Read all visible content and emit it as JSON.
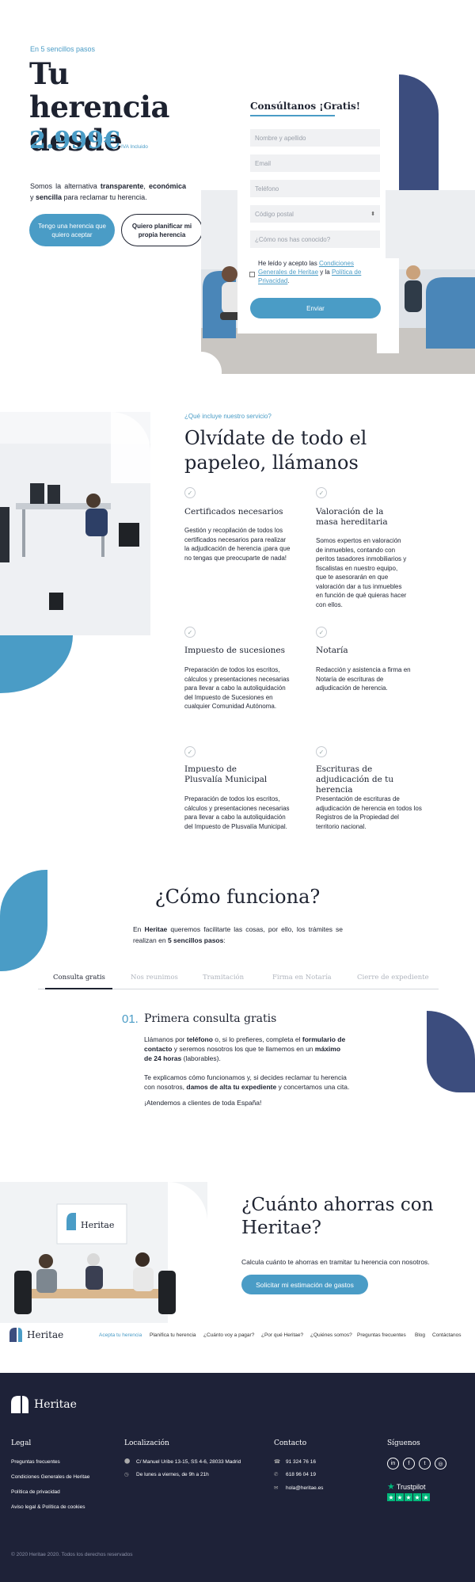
{
  "hero": {
    "kicker": "En 5 sencillos pasos",
    "title_line1": "Tu herencia",
    "title_line2": "desde",
    "price": "2.999€",
    "price_note": "IVA Incluido",
    "desc_pre": "Somos la alternativa ",
    "desc_b1": "transparente",
    "desc_mid": ", ",
    "desc_b2": "económica",
    "desc_and": " y ",
    "desc_b3": "sencilla",
    "desc_post": " para reclamar tu herencia.",
    "btn_accept": "Tengo una herencia que quiero aceptar",
    "btn_plan": "Quiero planificar mi propia herencia"
  },
  "form": {
    "title": "Consúltanos ¡Gratis!",
    "name_placeholder": "Nombre y apellido",
    "email_placeholder": "Email",
    "phone_placeholder": "Teléfono",
    "postal_placeholder": "Código postal",
    "source_placeholder": "¿Cómo nos has conocido?",
    "legal_pre": "He leído y acepto las ",
    "legal_link1": "Condiciones Generales de Heritae",
    "legal_mid": " y la ",
    "legal_link2": "Política de Privacidad",
    "legal_post": ".",
    "submit": "Enviar"
  },
  "services": {
    "kicker": "¿Qué incluye nuestro servicio?",
    "title": "Olvídate de todo el papeleo, llámanos",
    "items": [
      {
        "title": "Certificados necesarios",
        "desc": "Gestión y recopilación de todos los certificados necesarios para realizar la adjudicación de herencia ¡para que no tengas que preocuparte de nada!"
      },
      {
        "title": "Valoración de la masa hereditaria",
        "desc": "Somos expertos en valoración de inmuebles, contando con peritos tasadores inmobiliarios y fiscalistas en nuestro equipo, que te asesorarán en que valoración dar a tus inmuebles en función de qué quieras hacer con ellos."
      },
      {
        "title": "Impuesto de sucesiones",
        "desc": "Preparación de todos los escritos, cálculos y presentaciones necesarias para llevar a cabo la autoliquidación del Impuesto de Sucesiones en cualquier Comunidad Autónoma."
      },
      {
        "title": "Notaría",
        "desc": "Redacción y asistencia a firma en Notaría de escrituras de adjudicación de herencia."
      },
      {
        "title": "Impuesto de Plusvalía Municipal",
        "desc": "Preparación de todos los escritos, cálculos y presentaciones necesarias para llevar a cabo la autoliquidación del Impuesto de Plusvalía Municipal."
      },
      {
        "title": "Escrituras de adjudicación de tu herencia",
        "desc": "Presentación de escrituras de adjudicación de herencia en todos los Registros de la Propiedad del territorio nacional."
      }
    ]
  },
  "how": {
    "title": "¿Cómo funciona?",
    "intro_pre": "En ",
    "intro_b1": "Heritae",
    "intro_mid": " queremos facilitarte las cosas, por ello, los trámites se realizan en ",
    "intro_b2": "5 sencillos pasos",
    "intro_post": ":",
    "steps": [
      "Consulta gratis",
      "Nos reunimos",
      "Tramitación",
      "Firma en Notaría",
      "Cierre de expediente"
    ],
    "step_number": "01.",
    "step_title": "Primera consulta gratis",
    "p1_a": "Llámanos por ",
    "p1_b1": "teléfono",
    "p1_c": " o, si lo prefieres, completa el ",
    "p1_b2": "formulario de contacto",
    "p1_d": " y  seremos nosotros los que te llamemos en un ",
    "p1_b3": "máximo de 24 horas",
    "p1_e": " (laborables).",
    "p2_a": "Te explicamos cómo funcionamos y, si decides reclamar tu herencia con nosotros, ",
    "p2_b": "damos de alta tu expediente",
    "p2_c": " y concertamos una cita.",
    "p3": "¡Atendemos a clientes de toda España!"
  },
  "savings": {
    "title": "¿Cuánto ahorras con Heritae?",
    "desc": "Calcula cuánto te ahorras en tramitar tu herencia con nosotros.",
    "button": "Solicitar mi estimación de gastos",
    "screen_logo": "Heritae"
  },
  "nav": {
    "logo": "Heritae",
    "links": [
      "Acepta tu herencia",
      "Planifica tu herencia",
      "¿Cuánto voy a pagar?",
      "¿Por qué Heritae?",
      "¿Quiénes somos?",
      "Preguntas frecuentes",
      "Blog",
      "Contáctanos"
    ],
    "active_color": "#4a9cc6"
  },
  "footer": {
    "logo": "Heritae",
    "legal_head": "Legal",
    "legal_items": [
      "Preguntas frecuentes",
      "Condiciones Generales de Heritae",
      "Política de privacidad",
      "Aviso legal & Política de cookies"
    ],
    "loc_head": "Localización",
    "address": "C/ Manuel Uribe 13-15, SS 4-6, 28033 Madrid",
    "hours": "De lunes a viernes, de 9h a 21h",
    "contact_head": "Contacto",
    "phone": "91 324 76 16",
    "whatsapp": "618 96 04 19",
    "email": "hola@heritae.es",
    "social_head": "Síguenos",
    "social_icons": [
      "linkedin-icon",
      "facebook-icon",
      "twitter-icon",
      "instagram-icon"
    ],
    "trustpilot": "Trustpilot",
    "copyright": "© 2020 Heritae 2020. Todos los derechos reservados"
  },
  "colors": {
    "accent": "#4a9cc6",
    "navy": "#3c4d7e",
    "footer_bg": "#1e2238",
    "trustpilot": "#00b67a"
  }
}
